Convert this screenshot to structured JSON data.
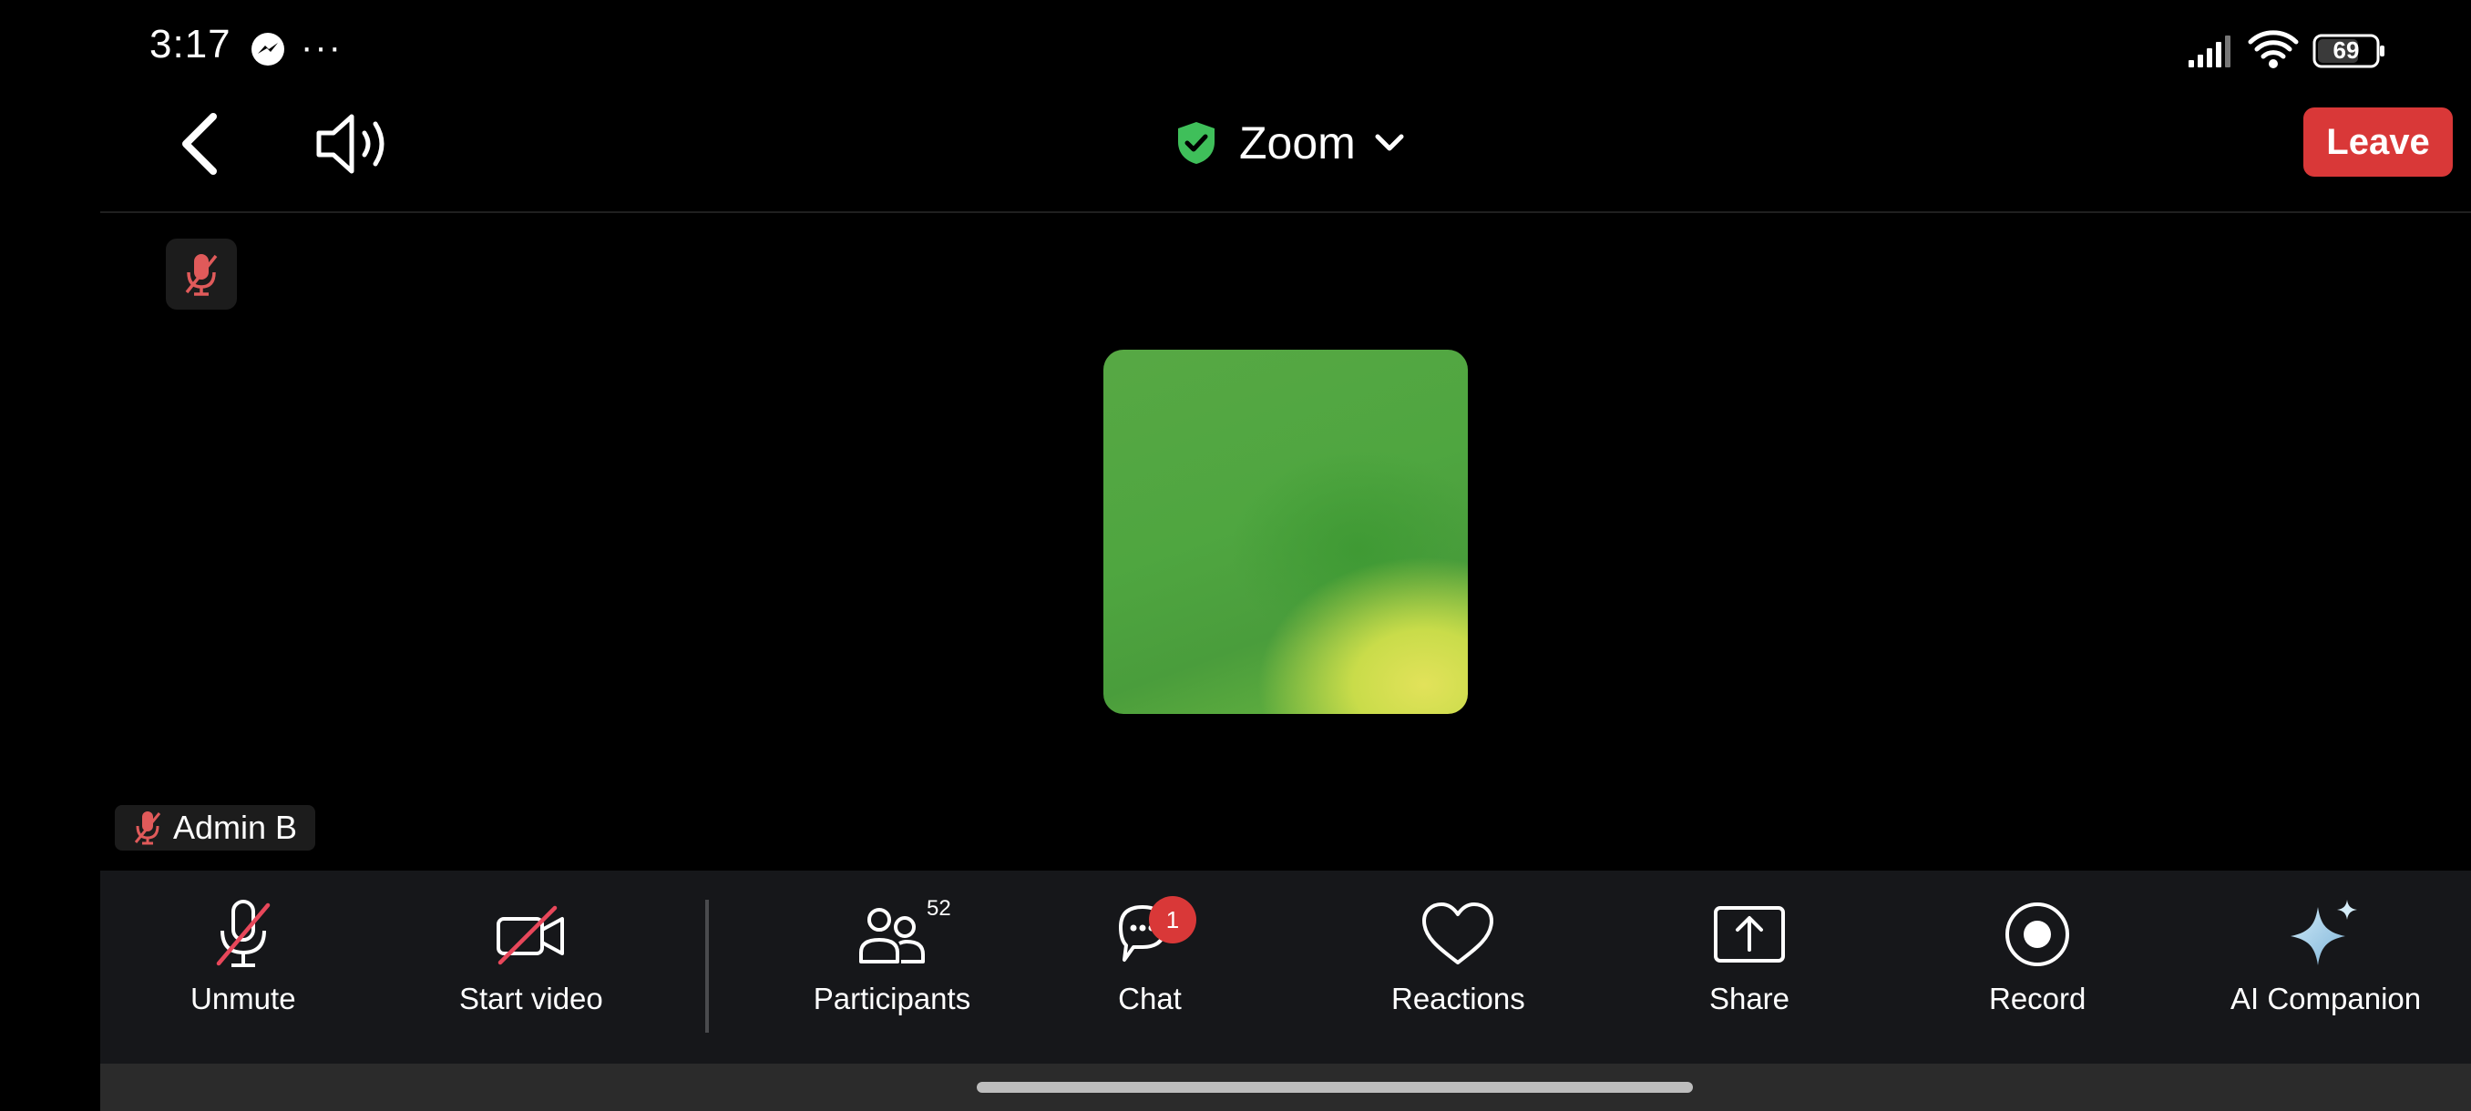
{
  "status_bar": {
    "time": "3:17",
    "more_dots": "···",
    "battery_level": "69",
    "icons": [
      "messenger-icon",
      "signal-icon",
      "wifi-icon",
      "battery-icon"
    ]
  },
  "header": {
    "meeting_title": "Zoom",
    "leave_label": "Leave",
    "icons": [
      "back-arrow-icon",
      "speaker-icon",
      "shield-check-icon",
      "chevron-down-icon"
    ]
  },
  "video": {
    "participant_name": "Admin B",
    "icons": [
      "mic-muted-icon"
    ]
  },
  "toolbar": {
    "unmute_label": "Unmute",
    "start_video_label": "Start video",
    "participants_label": "Participants",
    "participants_count": "52",
    "chat_label": "Chat",
    "chat_unread": "1",
    "reactions_label": "Reactions",
    "share_label": "Share",
    "record_label": "Record",
    "ai_companion_label": "AI Companion"
  },
  "colors": {
    "background": "#000000",
    "toolbar": "#16171a",
    "leave_red": "#d93838",
    "shield_green": "#3fbf5a",
    "muted_red": "#e05a5a"
  }
}
